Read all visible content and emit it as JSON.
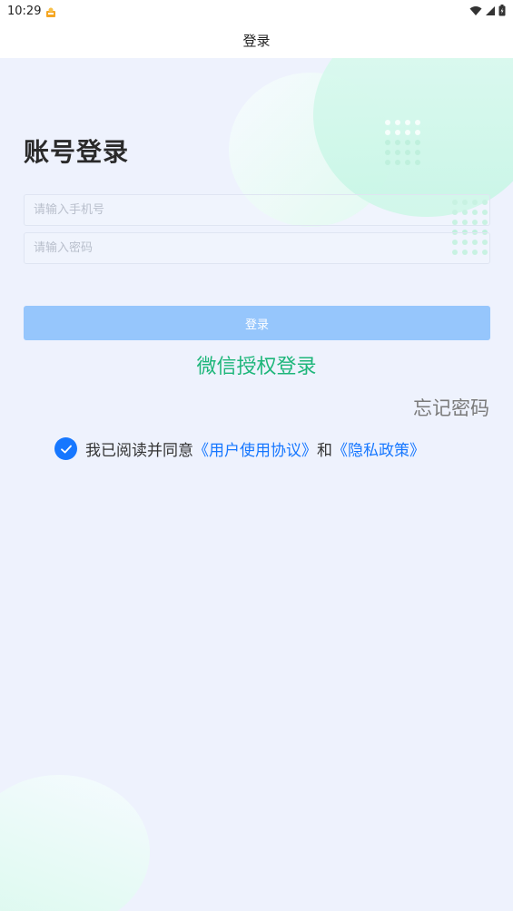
{
  "status_bar": {
    "time": "10:29",
    "icons": [
      "notification-app-icon",
      "wifi-icon",
      "cell-signal-icon",
      "battery-icon"
    ]
  },
  "header": {
    "title": "登录"
  },
  "login": {
    "title": "账号登录",
    "phone_placeholder": "请输入手机号",
    "password_placeholder": "请输入密码",
    "submit_label": "登录",
    "wechat_label": "微信授权登录",
    "forgot_label": "忘记密码"
  },
  "agreement": {
    "checked": true,
    "prefix": "我已阅读并同意",
    "user_agreement": "《用户使用协议》",
    "conjunction": "和",
    "privacy_policy": "《隐私政策》"
  },
  "colors": {
    "background": "#eef2fd",
    "button_disabled": "#96c6fc",
    "wechat_green": "#1db67a",
    "link_blue": "#1677ff"
  }
}
